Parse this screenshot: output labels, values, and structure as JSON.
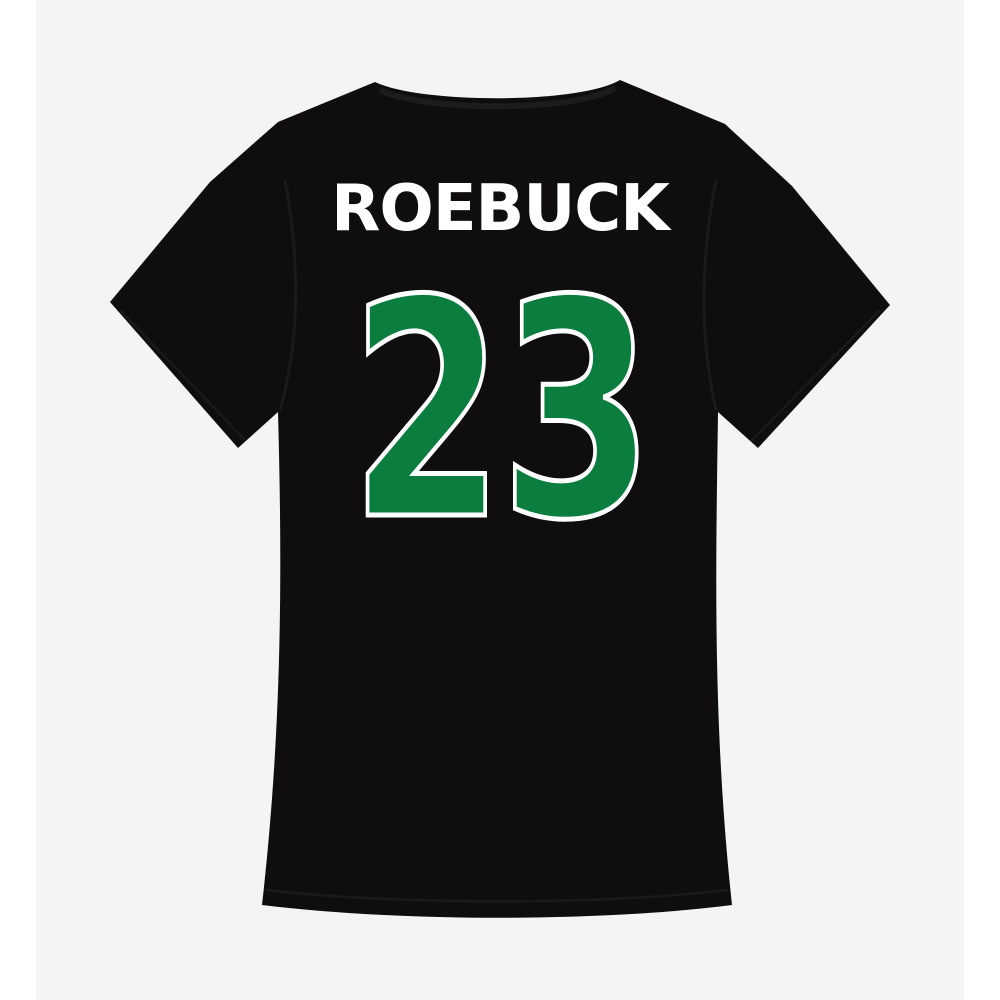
{
  "product": {
    "view": "back",
    "garment_color": "#0f0d0d",
    "backdrop_color": "#f4f4f4",
    "player_name": "ROEBUCK",
    "player_name_color": "#ffffff",
    "player_number": "23",
    "player_number_color": "#0b7d3e",
    "player_number_outline": "#ffffff"
  }
}
